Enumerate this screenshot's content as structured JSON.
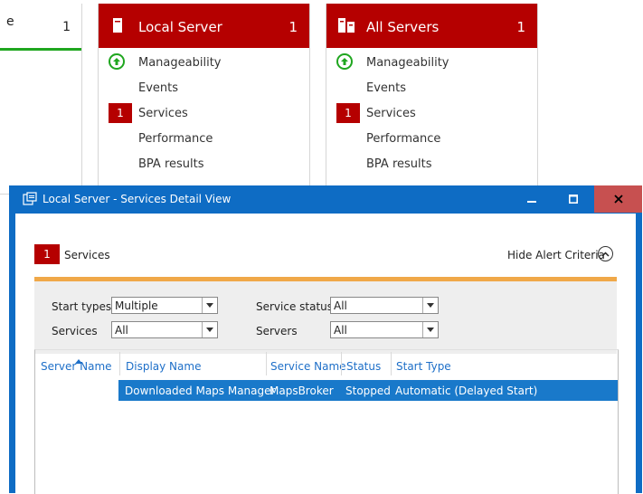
{
  "tiles": {
    "partial": {
      "title": "e",
      "count": "1"
    },
    "local_server": {
      "title": "Local Server",
      "count": "1",
      "items": {
        "manageability": "Manageability",
        "events": "Events",
        "services": "Services",
        "services_count": "1",
        "performance": "Performance",
        "bpa": "BPA results"
      }
    },
    "all_servers": {
      "title": "All Servers",
      "count": "1",
      "items": {
        "manageability": "Manageability",
        "events": "Events",
        "services": "Services",
        "services_count": "1",
        "performance": "Performance",
        "bpa": "BPA results"
      }
    }
  },
  "window": {
    "title": "Local Server - Services Detail View",
    "section": {
      "count": "1",
      "label": "Services"
    },
    "hide_criteria": "Hide Alert Criteria",
    "filters": {
      "start_types": {
        "label": "Start types",
        "value": "Multiple"
      },
      "services": {
        "label": "Services",
        "value": "All"
      },
      "service_status": {
        "label": "Service status",
        "value": "All"
      },
      "servers": {
        "label": "Servers",
        "value": "All"
      }
    },
    "columns": [
      "Server Name",
      "Display Name",
      "Service Name",
      "Status",
      "Start Type"
    ],
    "rows": [
      {
        "server_name": "",
        "display_name": "Downloaded Maps Manager",
        "service_name": "MapsBroker",
        "status": "Stopped",
        "start_type": "Automatic (Delayed Start)"
      }
    ]
  },
  "colors": {
    "alert_red": "#b50000",
    "ok_green": "#1fa61f",
    "title_blue": "#0e6cc4",
    "selection_blue": "#1979ca",
    "divider_orange": "#f0a848"
  }
}
